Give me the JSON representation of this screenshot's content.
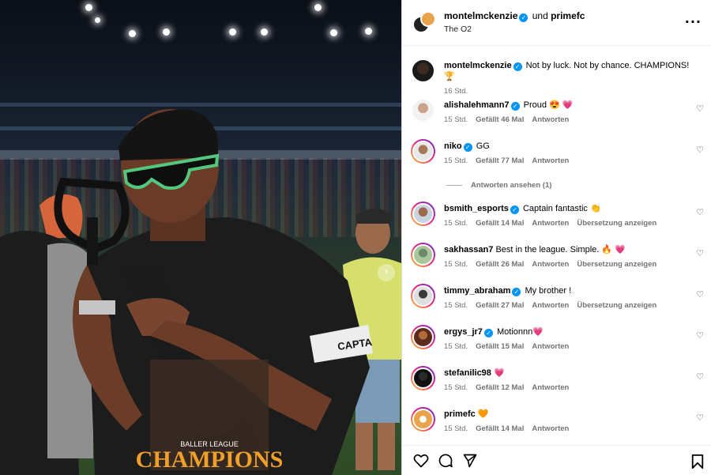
{
  "header": {
    "author": "montelmckenzie",
    "joiner": "und",
    "coauthor": "primefc",
    "location": "The O2",
    "more_icon": "more-options-icon"
  },
  "caption": {
    "username": "montelmckenzie",
    "verified": true,
    "text": "Not by luck. Not by chance. CHAMPIONS! 🏆",
    "time": "16 Std."
  },
  "comments": [
    {
      "username": "alishalehmann7",
      "verified": true,
      "text": "Proud 😍 💗",
      "time": "15 Std.",
      "likes": "Gefällt 46 Mal",
      "reply": "Antworten",
      "translate": ""
    },
    {
      "username": "niko",
      "verified": true,
      "text": "GG",
      "time": "15 Std.",
      "likes": "Gefällt 77 Mal",
      "reply": "Antworten",
      "translate": ""
    },
    {
      "username": "bsmith_esports",
      "verified": true,
      "text": "Captain fantastic 👏",
      "time": "15 Std.",
      "likes": "Gefällt 14 Mal",
      "reply": "Antworten",
      "translate": "Übersetzung anzeigen"
    },
    {
      "username": "sakhassan7",
      "verified": false,
      "text": "Best in the league. Simple. 🔥 💗",
      "time": "15 Std.",
      "likes": "Gefällt 26 Mal",
      "reply": "Antworten",
      "translate": "Übersetzung anzeigen"
    },
    {
      "username": "timmy_abraham",
      "verified": true,
      "text": "My brother !",
      "time": "15 Std.",
      "likes": "Gefällt 27 Mal",
      "reply": "Antworten",
      "translate": "Übersetzung anzeigen"
    },
    {
      "username": "ergys_jr7",
      "verified": true,
      "text": "Motionnn💗",
      "time": "15 Std.",
      "likes": "Gefällt 15 Mal",
      "reply": "Antworten",
      "translate": ""
    },
    {
      "username": "stefanilic98",
      "verified": false,
      "text": "💗",
      "time": "15 Std.",
      "likes": "Gefällt 12 Mal",
      "reply": "Antworten",
      "translate": ""
    },
    {
      "username": "primefc",
      "verified": false,
      "text": "🧡",
      "time": "15 Std.",
      "likes": "Gefällt 14 Mal",
      "reply": "Antworten",
      "translate": ""
    }
  ],
  "view_replies": "Antworten ansehen (1)",
  "photo_text": {
    "armband": "CAPTA",
    "shirt_small": "BALLER LEAGUE",
    "shirt_big": "CHAMPIONS"
  },
  "colors": {
    "verified": "#0095f6",
    "meta_gray": "#737373",
    "story_ring": [
      "#f9ce34",
      "#ee2a7b",
      "#6228d7"
    ]
  },
  "icons": [
    "heart-icon",
    "like-icon",
    "comment-icon",
    "share-icon",
    "bookmark-icon",
    "chevron-right-icon"
  ]
}
